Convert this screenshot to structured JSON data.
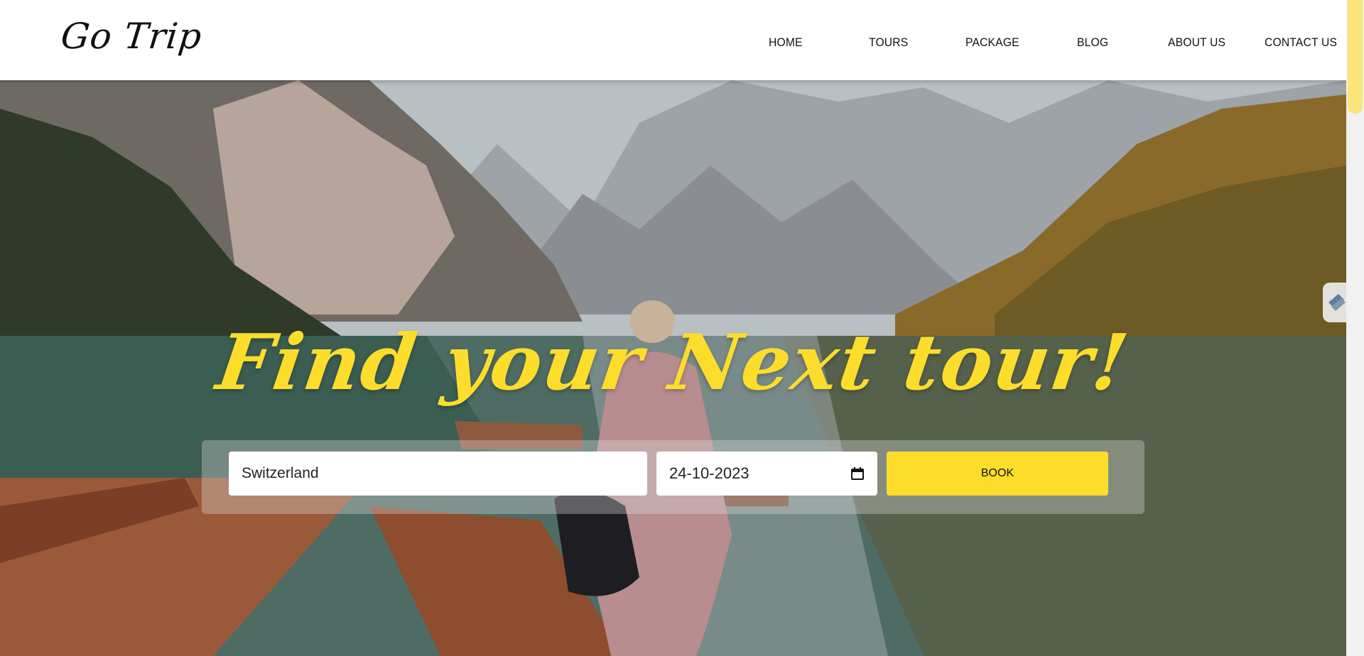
{
  "header": {
    "logo": "Go Trip",
    "nav": [
      "HOME",
      "TOURS",
      "PACKAGE",
      "BLOG",
      "ABOUT US",
      "CONTACT US"
    ]
  },
  "hero": {
    "headline": "Find your Next tour!",
    "booking": {
      "destination_value": "Switzerland",
      "date_value": "24-10-2023",
      "book_label": "BOOK"
    }
  },
  "colors": {
    "accent": "#fddd2c",
    "header_bg": "#ffffff",
    "text": "#111111"
  },
  "icons": [
    "calendar-icon",
    "floating-widget-icon"
  ]
}
